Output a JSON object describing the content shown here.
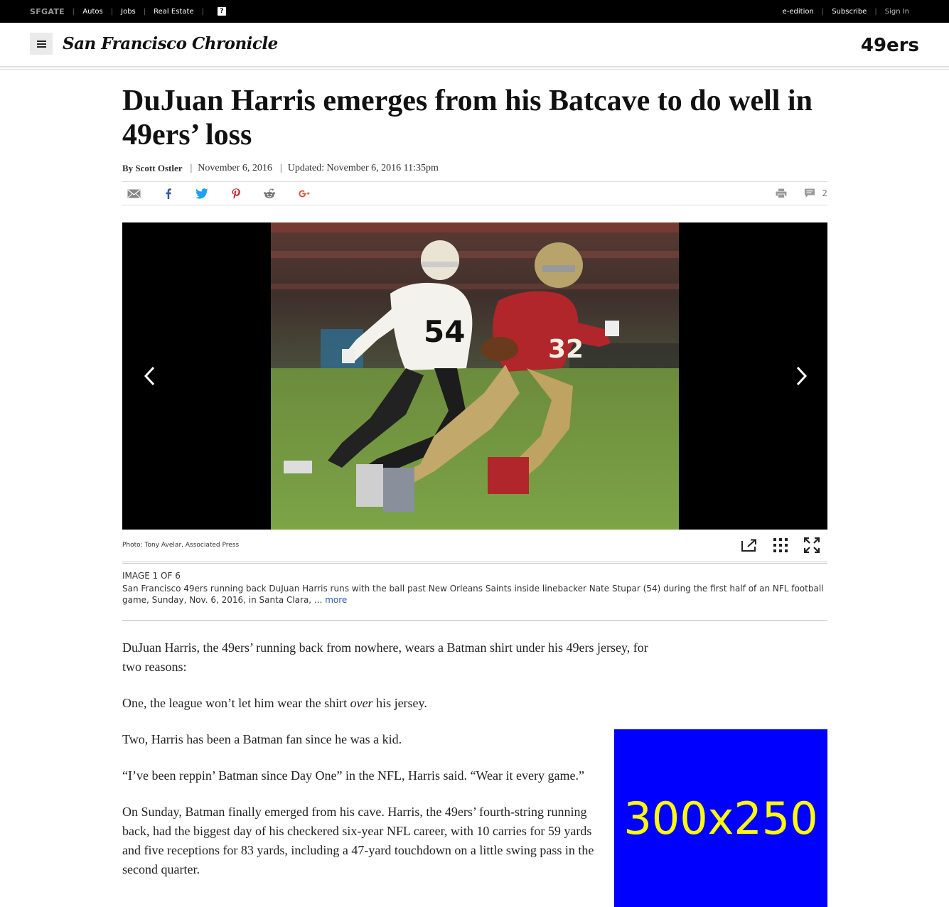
{
  "topbar": {
    "brand": "SFGATE",
    "links": [
      "Autos",
      "Jobs",
      "Real Estate"
    ],
    "help": "?",
    "right_links": [
      "e-edition",
      "Subscribe",
      "Sign In"
    ]
  },
  "masthead": {
    "logo": "San Francisco Chronicle",
    "section": "49ers"
  },
  "article": {
    "headline": "DuJuan Harris emerges from his Batcave to do well in 49ers’ loss",
    "author": "By Scott Ostler",
    "date": "November 6, 2016",
    "updated": "Updated: November 6, 2016 11:35pm",
    "comment_count": "2",
    "share_icons": [
      "email-icon",
      "facebook-icon",
      "twitter-icon",
      "pinterest-icon",
      "reddit-icon",
      "google-plus-icon"
    ]
  },
  "gallery": {
    "photo_credit": "Photo: Tony Avelar, Associated Press",
    "image_count": "IMAGE 1 OF 6",
    "caption": "San Francisco 49ers running back DuJuan Harris runs with the ball past New Orleans Saints inside linebacker Nate Stupar (54) during the first half of an NFL football game, Sunday, Nov. 6, 2016, in Santa Clara, ...",
    "more_label": "more",
    "jersey_left": "54",
    "jersey_right": "32"
  },
  "body": {
    "p1": "DuJuan Harris, the 49ers’ running back from nowhere, wears a Batman shirt under his 49ers jersey, for two reasons:",
    "p2_before": "One, the league won’t let him wear the shirt ",
    "p2_em": "over",
    "p2_after": " his jersey.",
    "p3": "Two, Harris has been a Batman fan since he was a kid.",
    "p4": "“I’ve been reppin’ Batman since Day One” in the NFL, Harris said. “Wear it every game.”",
    "p5": "On Sunday, Batman finally emerged from his cave. Harris, the 49ers’ fourth-string running back, had the biggest day of his checkered six-year NFL career, with 10 carries for 59 yards and five receptions for 83 yards, including a 47-yard touchdown on a little swing pass in the second quarter."
  },
  "ad": {
    "label": "300x250",
    "background": "#0000ff",
    "text_color": "#ffff00"
  }
}
